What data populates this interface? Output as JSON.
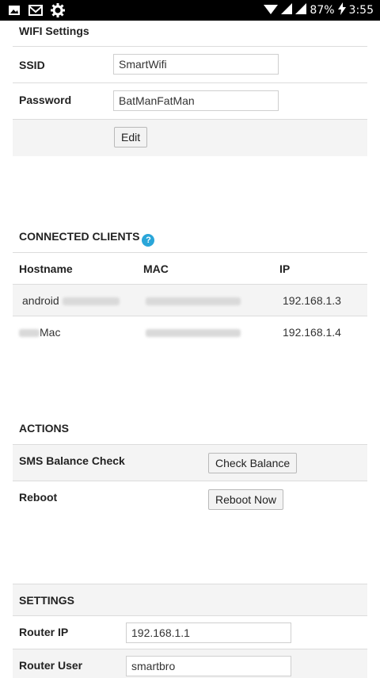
{
  "status_bar": {
    "left_icons": [
      "image-icon",
      "gmail-icon",
      "settings-gear-icon"
    ],
    "battery": "87%",
    "time": "3:55"
  },
  "wifi": {
    "title": "WIFI Settings",
    "ssid_label": "SSID",
    "ssid_value": "SmartWifi",
    "password_label": "Password",
    "password_value": "BatManFatMan",
    "edit_label": "Edit"
  },
  "clients": {
    "title": "CONNECTED CLIENTS",
    "help_icon": "?",
    "headers": [
      "Hostname",
      "MAC",
      "IP"
    ],
    "rows": [
      {
        "hostname": "android",
        "ip": "192.168.1.3"
      },
      {
        "hostname": "Mac",
        "ip": "192.168.1.4"
      }
    ]
  },
  "actions": {
    "title": "ACTIONS",
    "sms_label": "SMS Balance Check",
    "check_balance_label": "Check Balance",
    "reboot_label": "Reboot",
    "reboot_now_label": "Reboot Now"
  },
  "settings": {
    "title": "SETTINGS",
    "router_ip_label": "Router IP",
    "router_ip_value": "192.168.1.1",
    "router_user_label": "Router User",
    "router_user_value": "smartbro"
  }
}
